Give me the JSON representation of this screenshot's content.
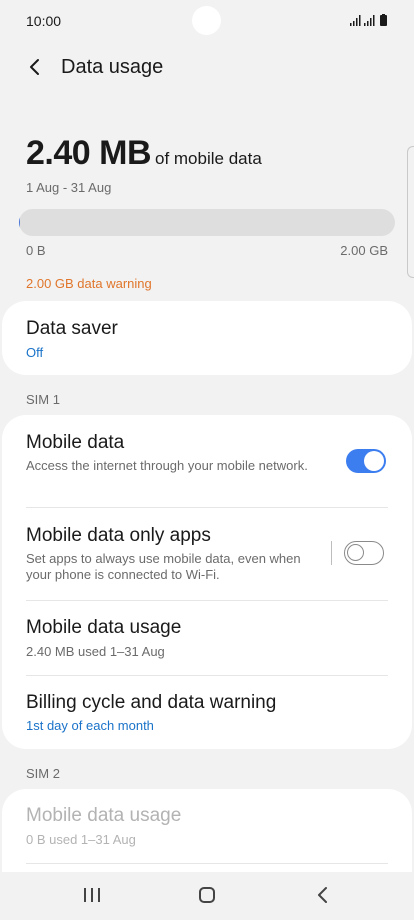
{
  "status_bar": {
    "time": "10:00"
  },
  "header": {
    "title": "Data usage"
  },
  "usage": {
    "amount": "2.40 MB",
    "suffix": "of mobile data",
    "period": "1 Aug - 31 Aug",
    "progress_fraction": 0.0012,
    "scale_min": "0 B",
    "scale_max": "2.00 GB",
    "warning": "2.00 GB data warning"
  },
  "data_saver": {
    "title": "Data saver",
    "status": "Off"
  },
  "sim1": {
    "label": "SIM 1",
    "mobile_data": {
      "title": "Mobile data",
      "desc": "Access the internet through your mobile network.",
      "enabled": true
    },
    "only_apps": {
      "title": "Mobile data only apps",
      "desc": "Set apps to always use mobile data, even when your phone is connected to Wi-Fi.",
      "enabled": false
    },
    "usage": {
      "title": "Mobile data usage",
      "desc": "2.40 MB used 1–31 Aug"
    },
    "billing": {
      "title": "Billing cycle and data warning",
      "desc": "1st day of each month"
    }
  },
  "sim2": {
    "label": "SIM 2",
    "usage": {
      "title": "Mobile data usage",
      "desc": "0 B used 1–31 Aug"
    }
  },
  "colors": {
    "accent": "#3c7df0",
    "link": "#1a73c9",
    "warning": "#e0762b",
    "background": "#f2f2f2"
  },
  "icons": {
    "back": "chevron-left-icon",
    "recents": "recent-apps-icon",
    "home": "home-icon",
    "nav_back": "nav-back-icon"
  }
}
